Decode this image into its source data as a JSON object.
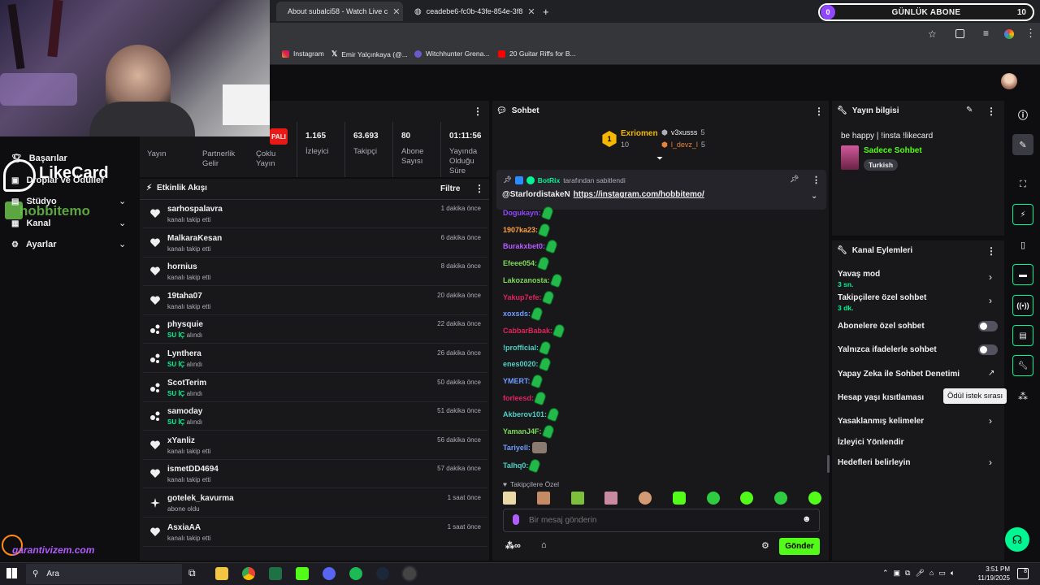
{
  "goal": {
    "current": "0",
    "label": "GÜNLÜK ABONE",
    "target": "10"
  },
  "browser": {
    "tabs": [
      {
        "title": "About subalci58 - Watch Live c"
      },
      {
        "title": "ceadebe6-fc0b-43fe-854e-3f8"
      }
    ],
    "bookmarks": [
      "Instagram",
      "Emir Yalçınkaya (@...",
      "Witchhunter Grena...",
      "20 Guitar Riffs for B..."
    ]
  },
  "overlay": {
    "likecard": "LikeCard",
    "hobbitemo": "hobbitemo",
    "garantivizem": "garantivizem.com"
  },
  "left_nav": {
    "items": [
      {
        "label": "Başarılar"
      },
      {
        "label": "Droplar ve Ödüller"
      },
      {
        "label": "Stüdyo"
      },
      {
        "label": "Kanal"
      },
      {
        "label": "Ayarlar"
      }
    ]
  },
  "stats": {
    "badge": "PALI",
    "items": [
      {
        "label": "Yayın",
        "value": ""
      },
      {
        "label": "Partnerlik Gelir",
        "value": ""
      },
      {
        "label": "Çoklu Yayın",
        "value": ""
      },
      {
        "label": "İzleyici",
        "value": "1.165"
      },
      {
        "label": "Takipçi",
        "value": "63.693"
      },
      {
        "label": "Abone Sayısı",
        "value": "80"
      },
      {
        "label": "Yayında Olduğu Süre",
        "value": "01:11:56"
      }
    ]
  },
  "activity": {
    "title": "Etkinlik Akışı",
    "filter": "Filtre",
    "items": [
      {
        "name": "sarhospalavra",
        "action": "kanalı takip etti",
        "reward": "",
        "time": "1 dakika önce",
        "icon": "heart-icon"
      },
      {
        "name": "MalkaraKesan",
        "action": "kanalı takip etti",
        "reward": "",
        "time": "6 dakika önce",
        "icon": "heart-icon"
      },
      {
        "name": "hornius",
        "action": "kanalı takip etti",
        "reward": "",
        "time": "8 dakika önce",
        "icon": "heart-icon"
      },
      {
        "name": "19taha07",
        "action": "kanalı takip etti",
        "reward": "",
        "time": "20 dakika önce",
        "icon": "heart-icon"
      },
      {
        "name": "physquie",
        "action": "alındı",
        "reward": "SU İÇ",
        "time": "22 dakika önce",
        "icon": "reward-icon"
      },
      {
        "name": "Lynthera",
        "action": "alındı",
        "reward": "SU İÇ",
        "time": "26 dakika önce",
        "icon": "reward-icon"
      },
      {
        "name": "ScotTerim",
        "action": "alındı",
        "reward": "SU İÇ",
        "time": "50 dakika önce",
        "icon": "reward-icon"
      },
      {
        "name": "samoday",
        "action": "alındı",
        "reward": "SU İÇ",
        "time": "51 dakika önce",
        "icon": "reward-icon"
      },
      {
        "name": "xYanliz",
        "action": "kanalı takip etti",
        "reward": "",
        "time": "56 dakika önce",
        "icon": "heart-icon"
      },
      {
        "name": "ismetDD4694",
        "action": "kanalı takip etti",
        "reward": "",
        "time": "57 dakika önce",
        "icon": "heart-icon"
      },
      {
        "name": "gotelek_kavurma",
        "action": "abone oldu",
        "reward": "",
        "time": "1 saat önce",
        "icon": "sparkle-icon"
      },
      {
        "name": "AsxiaAA",
        "action": "kanalı takip etti",
        "reward": "",
        "time": "1 saat önce",
        "icon": "heart-icon"
      }
    ]
  },
  "chat": {
    "title": "Sohbet",
    "leaderboard": [
      {
        "rank": "1",
        "name": "Exriomen",
        "count": "10"
      },
      {
        "name": "v3xusss",
        "count": "5"
      },
      {
        "name": "l_devz_l",
        "count": "5"
      }
    ],
    "pinned": {
      "by": "BotRix",
      "by_suffix": "tarafından sabitlendi",
      "mention": "@StarlordistakeN",
      "link": "https://instagram.com/hobbitemo/"
    },
    "messages": [
      {
        "user": "Dogukayn:",
        "color": "#9147ff"
      },
      {
        "user": "1907ka23:",
        "color": "#ff9f43"
      },
      {
        "user": "Burakxbet0:",
        "color": "#b45cff"
      },
      {
        "user": "Efeee054:",
        "color": "#7ed957"
      },
      {
        "user": "Lakozanosta:",
        "color": "#7ed957"
      },
      {
        "user": "Yakup7efe:",
        "color": "#e0245e"
      },
      {
        "user": "xoxsds:",
        "color": "#6f9cff"
      },
      {
        "user": "CabbarBabak:",
        "color": "#e0245e"
      },
      {
        "user": "!profficial:",
        "color": "#4fd1c5"
      },
      {
        "user": "enes0020:",
        "color": "#4fd1c5"
      },
      {
        "user": "YMERT:",
        "color": "#6f9cff"
      },
      {
        "user": "forleesd:",
        "color": "#e0245e"
      },
      {
        "user": "Akberov101:",
        "color": "#4fd1c5"
      },
      {
        "user": "YamanJ4F:",
        "color": "#7ed957"
      },
      {
        "user": "Tariyell:",
        "color": "#6f9cff"
      },
      {
        "user": "Talhq0:",
        "color": "#4fd1c5"
      }
    ],
    "follower_only": "Takipçilere Özel",
    "input_placeholder": "Bir mesaj gönderin",
    "send": "Gönder"
  },
  "stream_info": {
    "title": "Yayın bilgisi",
    "stream_title": "be happy | !insta !likecard",
    "category": "Sadece Sohbet",
    "tag": "Turkish"
  },
  "channel_actions": {
    "title": "Kanal Eylemleri",
    "items": [
      {
        "label": "Yavaş mod",
        "sub": "3 sn."
      },
      {
        "label": "Takipçilere özel sohbet",
        "sub": "3 dk."
      },
      {
        "label": "Abonelere özel sohbet",
        "sub": ""
      },
      {
        "label": "Yalnızca ifadelerle sohbet",
        "sub": ""
      },
      {
        "label": "Yapay Zeka ile Sohbet Denetimi",
        "sub": ""
      },
      {
        "label": "Hesap yaşı kısıtlaması",
        "sub": ""
      },
      {
        "label": "Yasaklanmış kelimeler",
        "sub": ""
      },
      {
        "label": "İzleyici Yönlendir",
        "sub": ""
      },
      {
        "label": "Hedefleri belirleyin",
        "sub": ""
      }
    ],
    "tooltip": "Ödül istek sırası"
  },
  "taskbar": {
    "search": "Ara",
    "time": "3:51 PM",
    "date": "11/19/2025",
    "notif": "8"
  }
}
